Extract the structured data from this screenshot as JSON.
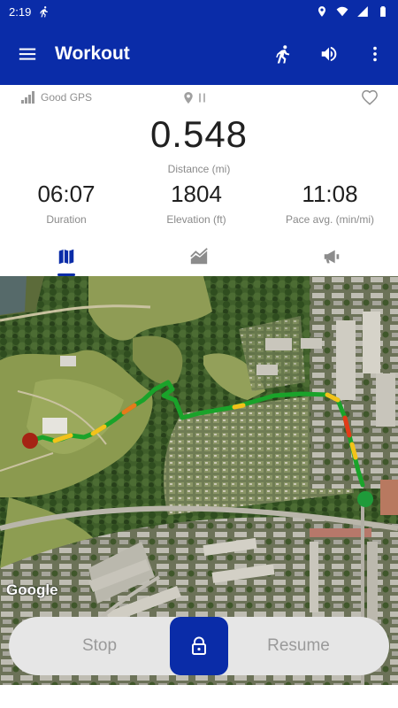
{
  "status_bar": {
    "time": "2:19",
    "icons": [
      "run-icon",
      "location-icon",
      "wifi-icon",
      "signal-icon",
      "battery-icon"
    ]
  },
  "app_bar": {
    "title": "Workout",
    "actions": [
      "run-icon",
      "volume-icon",
      "more-vert-icon"
    ],
    "color": "#0a2ca8"
  },
  "gps": {
    "status": "Good GPS"
  },
  "distance": {
    "value": "0.548",
    "label": "Distance (mi)"
  },
  "metrics": [
    {
      "value": "06:07",
      "label": "Duration"
    },
    {
      "value": "1804",
      "label": "Elevation (ft)"
    },
    {
      "value": "11:08",
      "label": "Pace avg. (min/mi)"
    }
  ],
  "tabs": [
    {
      "icon": "map-icon",
      "active": true
    },
    {
      "icon": "chart-icon",
      "active": false
    },
    {
      "icon": "megaphone-icon",
      "active": false
    }
  ],
  "map": {
    "attribution": "Google"
  },
  "controls": {
    "stop": "Stop",
    "resume": "Resume",
    "lock_icon": "lock-icon"
  }
}
